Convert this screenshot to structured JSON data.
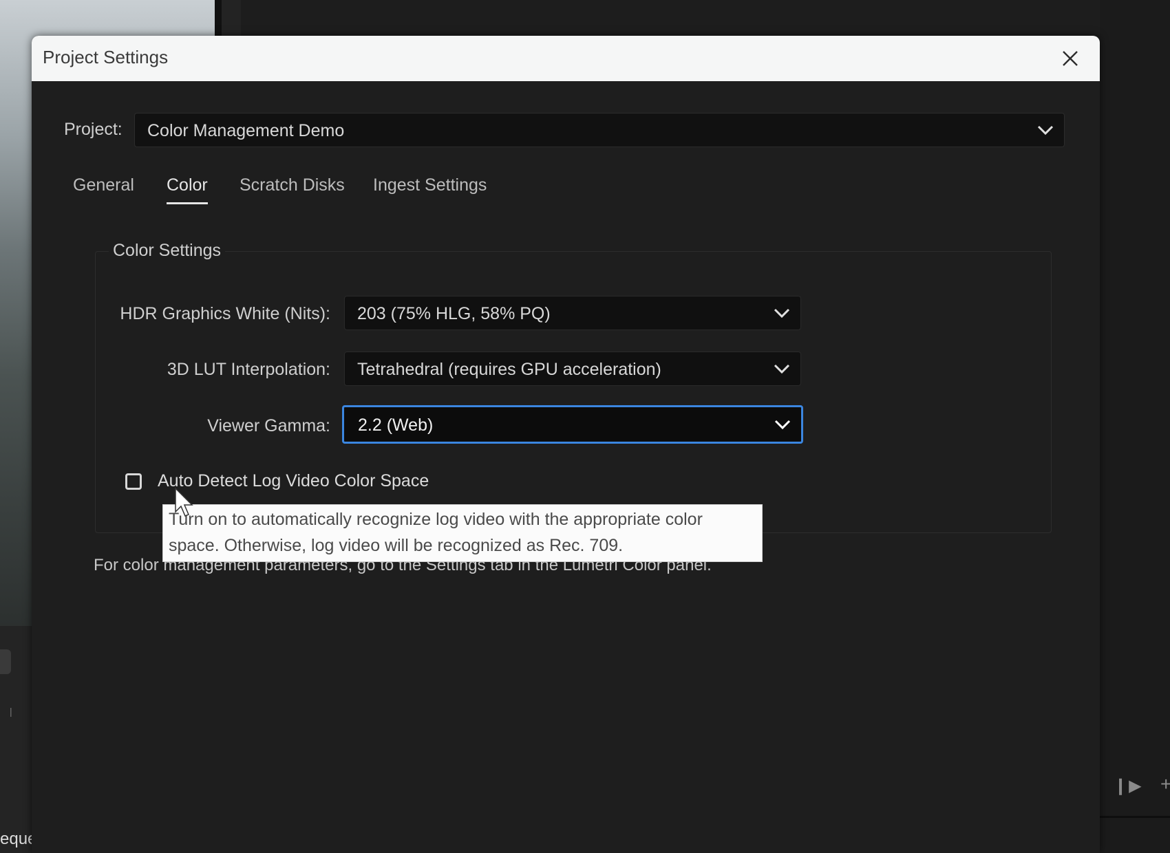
{
  "background": {
    "sequence_fragment": "eque"
  },
  "dialog": {
    "title": "Project Settings",
    "project_label": "Project:",
    "project_value": "Color Management Demo",
    "tabs": [
      {
        "label": "General",
        "active": false
      },
      {
        "label": "Color",
        "active": true
      },
      {
        "label": "Scratch Disks",
        "active": false
      },
      {
        "label": "Ingest Settings",
        "active": false
      }
    ],
    "color_settings": {
      "group_title": "Color Settings",
      "hdr_label": "HDR Graphics White (Nits):",
      "hdr_value": "203 (75% HLG, 58% PQ)",
      "lut_label": "3D LUT Interpolation:",
      "lut_value": "Tetrahedral (requires GPU acceleration)",
      "gamma_label": "Viewer Gamma:",
      "gamma_value": "2.2 (Web)",
      "auto_detect_label": "Auto Detect Log Video Color Space",
      "auto_detect_checked": false
    },
    "tooltip": "Turn on to automatically recognize log video with the appropriate color space. Otherwise, log video will be recognized as Rec. 709.",
    "footnote": "For color management parameters, go to the Settings tab in the Lumetri Color panel."
  },
  "colors": {
    "focus_accent": "#3b86e0",
    "dialog_bg": "#1e1e1e",
    "titlebar_bg": "#f5f6f6"
  }
}
